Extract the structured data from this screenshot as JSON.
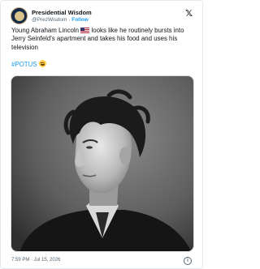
{
  "author": {
    "display_name": "Presidential Wisdom",
    "handle": "@PrezWisdom",
    "separator": "·",
    "follow_label": "Follow"
  },
  "tweet": {
    "text_before_flag": "Young Abraham Lincoln",
    "text_after_flag": "looks like he routinely bursts into Jerry Seinfeld's apartment and takes his food and uses his television",
    "hashtag": "#POTUS"
  },
  "footer": {
    "timestamp": "7:59 PM · Jul 15, 2026"
  },
  "icons": {
    "logo": "x-logo-icon",
    "flag": "us-flag-icon",
    "emoji": "laughing-emoji-icon",
    "info": "info-icon"
  },
  "colors": {
    "accent": "#1d9bf0",
    "text": "#0f1419",
    "muted": "#536471"
  }
}
